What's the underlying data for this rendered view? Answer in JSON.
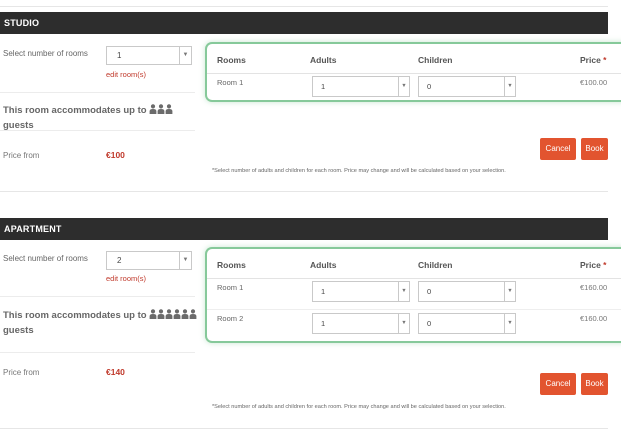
{
  "sections": [
    {
      "title": "STUDIO",
      "select_label": "Select number of rooms",
      "rooms_value": "1",
      "edit_link": "edit room(s)",
      "accommodates_prefix": "This room accommodates up to",
      "accommodates_suffix": "guests",
      "guest_count": 3,
      "price_label": "Price from",
      "price_value": "€100",
      "table": {
        "headers": {
          "rooms": "Rooms",
          "adults": "Adults",
          "children": "Children",
          "price": "Price",
          "required": "*"
        },
        "rows": [
          {
            "room": "Room 1",
            "adults": "1",
            "children": "0",
            "price": "€100.00"
          }
        ]
      },
      "cancel_label": "Cancel",
      "book_label": "Book",
      "note": "*Select number of adults and children for each room. Price may change and will be calculated based on your selection."
    },
    {
      "title": "APARTMENT",
      "select_label": "Select number of rooms",
      "rooms_value": "2",
      "edit_link": "edit room(s)",
      "accommodates_prefix": "This room accommodates up to",
      "accommodates_suffix": "guests",
      "guest_count": 6,
      "price_label": "Price from",
      "price_value": "€140",
      "table": {
        "headers": {
          "rooms": "Rooms",
          "adults": "Adults",
          "children": "Children",
          "price": "Price",
          "required": "*"
        },
        "rows": [
          {
            "room": "Room 1",
            "adults": "1",
            "children": "0",
            "price": "€160.00"
          },
          {
            "room": "Room 2",
            "adults": "1",
            "children": "0",
            "price": "€160.00"
          }
        ]
      },
      "cancel_label": "Cancel",
      "book_label": "Book",
      "note": "*Select number of adults and children for each room. Price may change and will be calculated based on your selection."
    }
  ],
  "icons": {
    "guest": "person-icon",
    "dropdown": "chevron-down-icon"
  },
  "colors": {
    "accent": "#e2542f",
    "link": "#c0392b",
    "highlight_border": "#86c99a",
    "header_bar": "#2d2d2d"
  }
}
